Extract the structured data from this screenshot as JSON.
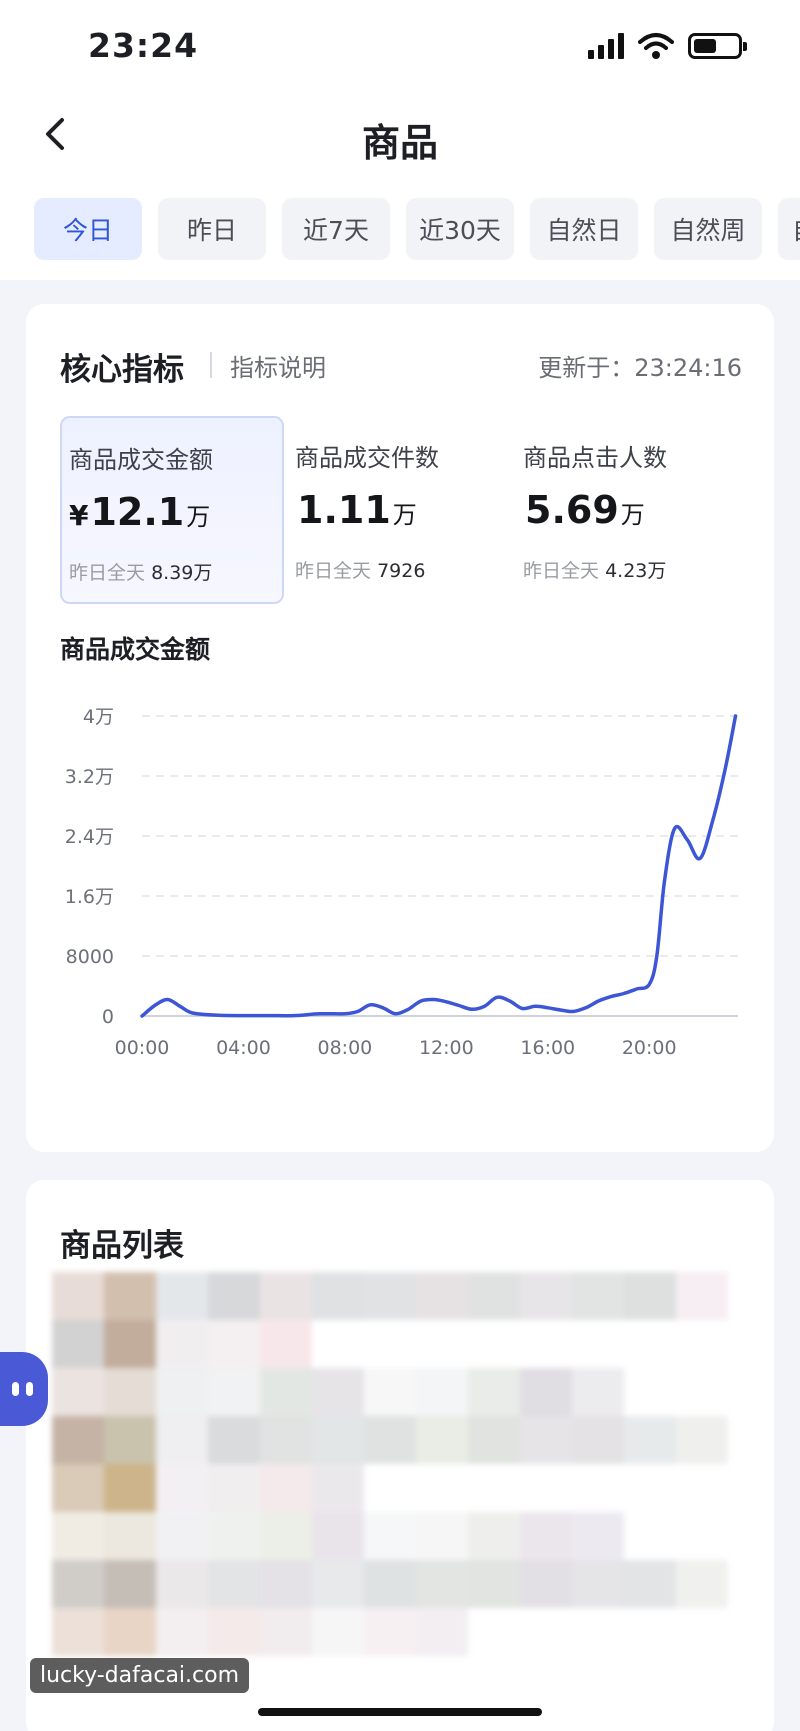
{
  "status_bar": {
    "time": "23:24"
  },
  "nav": {
    "title": "商品"
  },
  "tabs": [
    {
      "label": "今日",
      "active": true
    },
    {
      "label": "昨日",
      "active": false
    },
    {
      "label": "近7天",
      "active": false
    },
    {
      "label": "近30天",
      "active": false
    },
    {
      "label": "自然日",
      "active": false
    },
    {
      "label": "自然周",
      "active": false
    },
    {
      "label": "自然月",
      "active": false
    }
  ],
  "core": {
    "title": "核心指标",
    "help": "指标说明",
    "updated": "更新于：23:24:16",
    "metrics": [
      {
        "label": "商品成交金额",
        "currency": "¥",
        "value": "12.1",
        "unit": "万",
        "sub_label": "昨日全天",
        "sub_value": "8.39",
        "sub_unit": "万"
      },
      {
        "label": "商品成交件数",
        "currency": "",
        "value": "1.11",
        "unit": "万",
        "sub_label": "昨日全天",
        "sub_value": "7926",
        "sub_unit": ""
      },
      {
        "label": "商品点击人数",
        "currency": "",
        "value": "5.69",
        "unit": "万",
        "sub_label": "昨日全天",
        "sub_value": "4.23",
        "sub_unit": "万"
      }
    ]
  },
  "chart_data": {
    "type": "line",
    "title": "商品成交金额",
    "xlabel": "",
    "ylabel": "",
    "x_ticks": [
      "00:00",
      "04:00",
      "08:00",
      "12:00",
      "16:00",
      "20:00"
    ],
    "y_ticks": [
      "0",
      "8000",
      "1.6万",
      "2.4万",
      "3.2万",
      "4万"
    ],
    "xlim": [
      0,
      23.5
    ],
    "ylim": [
      0,
      40000
    ],
    "grid": true,
    "series": [
      {
        "color": "#3d56d6",
        "x": [
          0,
          0.5,
          1.0,
          1.5,
          2.0,
          3.0,
          4.0,
          5.0,
          6.0,
          7.0,
          8.0,
          8.5,
          9.0,
          9.5,
          10.0,
          10.5,
          11.0,
          11.5,
          12.0,
          12.5,
          13.0,
          13.5,
          14.0,
          14.5,
          15.0,
          15.5,
          16.0,
          16.5,
          17.0,
          17.5,
          18.0,
          18.5,
          19.0,
          19.5,
          20.0,
          20.3,
          20.6,
          21.0,
          21.5,
          22.0,
          22.5,
          23.0,
          23.4
        ],
        "y": [
          0,
          1400,
          2200,
          1300,
          400,
          100,
          50,
          50,
          50,
          300,
          300,
          600,
          1500,
          1100,
          300,
          900,
          2000,
          2200,
          1900,
          1400,
          900,
          1300,
          2500,
          2000,
          1000,
          1300,
          1100,
          800,
          600,
          1100,
          2000,
          2600,
          3000,
          3600,
          4200,
          8000,
          18000,
          25000,
          23500,
          21000,
          26000,
          33000,
          40000
        ]
      }
    ]
  },
  "list": {
    "title": "商品列表"
  },
  "watermark": "lucky-dafacai.com"
}
